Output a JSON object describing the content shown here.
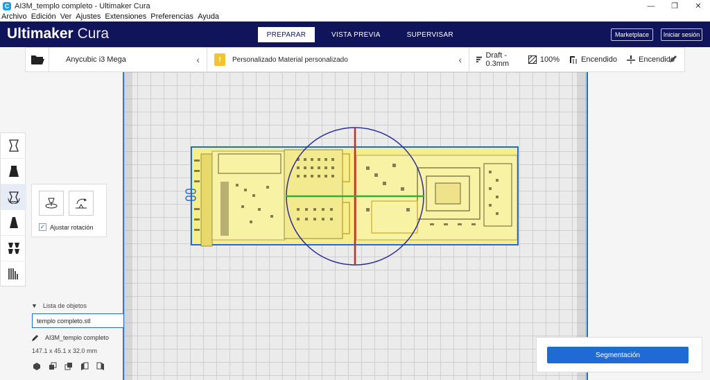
{
  "window": {
    "title": "AI3M_templo completo - Ultimaker Cura",
    "app_icon": "C",
    "controls": {
      "minimize": "—",
      "restore": "❐",
      "close": "✕"
    }
  },
  "menu": [
    "Archivo",
    "Edición",
    "Ver",
    "Ajustes",
    "Extensiones",
    "Preferencias",
    "Ayuda"
  ],
  "header": {
    "brand_bold": "Ultimaker",
    "brand_light": "Cura",
    "stages": [
      "PREPARAR",
      "VISTA PREVIA",
      "SUPERVISAR"
    ],
    "active_stage": "PREPARAR",
    "marketplace": "Marketplace",
    "signin": "Iniciar sesión"
  },
  "toolbar": {
    "printer": "Anycubic i3 Mega",
    "material_badge": "!",
    "material": "Personalizado Material personalizado",
    "profile": "Draft - 0.3mm",
    "infill": "100%",
    "support": "Encendido",
    "adhesion": "Encendido"
  },
  "rotate_panel": {
    "lay_flat_label": "Ajustar rotación",
    "checked": true
  },
  "object_list": {
    "toggle": "▼",
    "title": "Lista de objetos",
    "selected": "templo completo.stl",
    "project_name": "AI3M_templo completo",
    "dimensions": "147.1 x 45.1 x 32.0 mm"
  },
  "slice": {
    "button": "Segmentación"
  },
  "colors": {
    "header": "#10155b",
    "accent": "#1e6bd6",
    "model": "#f6ee8a",
    "material_badge": "#f4c430"
  }
}
